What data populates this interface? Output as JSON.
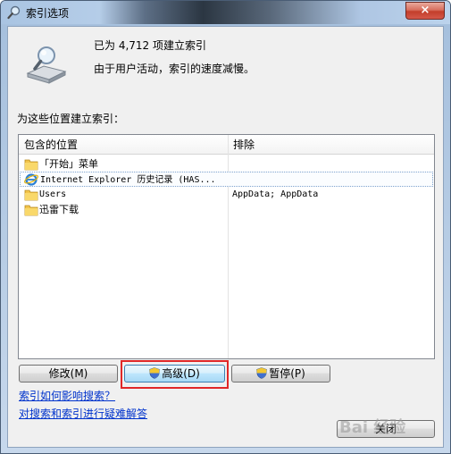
{
  "window": {
    "title": "索引选项",
    "close_glyph": "×"
  },
  "status": {
    "indexed_count": "已为 4,712 项建立索引",
    "message": "由于用户活动，索引的速度减慢。"
  },
  "locations": {
    "label": "为这些位置建立索引：",
    "header_included": "包含的位置",
    "header_exclude": "排除",
    "rows": [
      {
        "icon": "folder-icon",
        "name": "「开始」菜单",
        "exclude": ""
      },
      {
        "icon": "internet-explorer-icon",
        "name": "Internet Explorer 历史记录 (HAS...",
        "exclude": ""
      },
      {
        "icon": "folder-icon",
        "name": "Users",
        "exclude": "AppData; AppData"
      },
      {
        "icon": "folder-icon",
        "name": "迅雷下载",
        "exclude": ""
      }
    ]
  },
  "buttons": {
    "modify": "修改(M)",
    "advanced": "高级(D)",
    "pause": "暂停(P)",
    "close": "关闭"
  },
  "links": {
    "how_affects": "索引如何影响搜索？",
    "troubleshoot": "对搜索和索引进行疑难解答"
  },
  "colors": {
    "highlight": "#e02727",
    "link": "#0033cc"
  },
  "watermark": "Bai 经验"
}
